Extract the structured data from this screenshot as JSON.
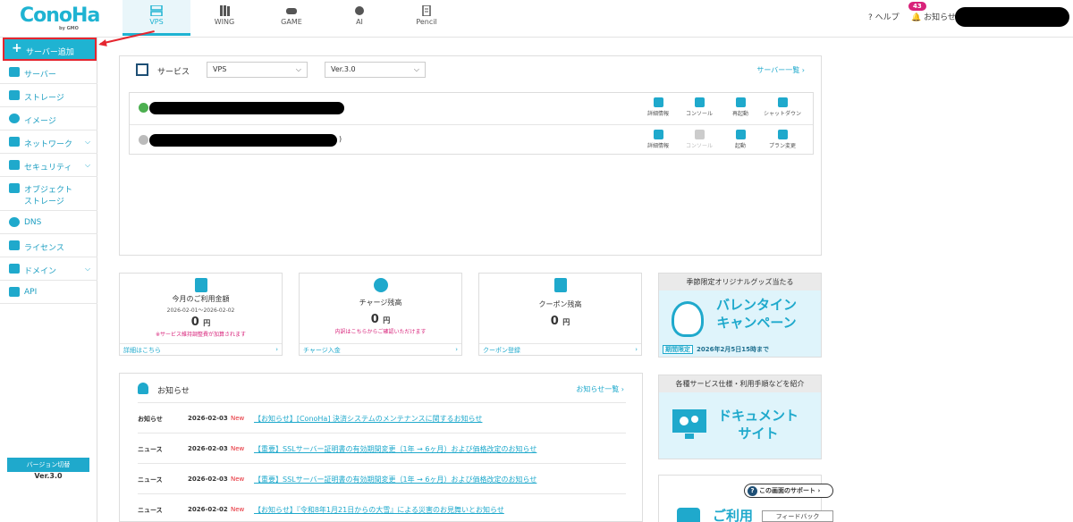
{
  "header": {
    "logo": "ConoHa",
    "logo_sub": "by GMO",
    "tabs": [
      {
        "label": "VPS",
        "icon": "server-icon",
        "active": true
      },
      {
        "label": "WING",
        "icon": "books-icon",
        "active": false
      },
      {
        "label": "GAME",
        "icon": "gamepad-icon",
        "active": false
      },
      {
        "label": "AI",
        "icon": "ai-chip-icon",
        "active": false
      },
      {
        "label": "Pencil",
        "icon": "pencil-icon",
        "active": false
      }
    ],
    "help_label": "ヘルプ",
    "notification_label": "お知らせ",
    "notification_count": "43"
  },
  "sidebar": {
    "add_server_label": "サーバー追加",
    "items": [
      {
        "label": "サーバー",
        "icon": "server-icon"
      },
      {
        "label": "ストレージ",
        "icon": "storage-icon"
      },
      {
        "label": "イメージ",
        "icon": "globe-icon"
      },
      {
        "label": "ネットワーク",
        "icon": "network-icon"
      },
      {
        "label": "セキュリティ",
        "icon": "key-icon"
      },
      {
        "label": "オブジェクト",
        "label2": "ストレージ",
        "icon": "folder-icon"
      },
      {
        "label": "DNS",
        "icon": "globe-icon"
      },
      {
        "label": "ライセンス",
        "icon": "license-icon"
      },
      {
        "label": "ドメイン",
        "icon": "domain-icon"
      },
      {
        "label": "API",
        "icon": "api-icon"
      }
    ],
    "version_switch_label": "バージョン切替",
    "version_label": "Ver.3.0"
  },
  "services": {
    "title": "サービス",
    "type_select": "VPS",
    "version_select": "Ver.3.0",
    "list_link": "サーバー一覧",
    "row1_suffix": "",
    "row2_suffix": ")",
    "row1_actions": [
      "詳細情報",
      "コンソール",
      "再起動",
      "シャットダウン"
    ],
    "row2_actions": [
      "詳細情報",
      "コンソール",
      "起動",
      "プラン変更"
    ]
  },
  "cards": [
    {
      "title": "今月のご利用金額",
      "sub": "2026-02-01～2026-02-02",
      "value": "0",
      "unit": "円",
      "note": "※サービス維持調整費が加算されます",
      "footer": "詳細はこちら"
    },
    {
      "title": "チャージ残高",
      "sub": "",
      "value": "0",
      "unit": "円",
      "note": "内訳はこちらからご確認いただけます",
      "footer": "チャージ入金"
    },
    {
      "title": "クーポン残高",
      "sub": "",
      "value": "0",
      "unit": "円",
      "note": "",
      "footer": "クーポン登録"
    }
  ],
  "banners": {
    "valentine_head": "季節限定オリジナルグッズ当たる",
    "valentine_line1": "バレンタイン",
    "valentine_line2": "キャンペーン",
    "valentine_tag": "期間限定",
    "valentine_date": "2026年2月5日15時まで",
    "docs_head": "各種サービス仕様・利用手順などを紹介",
    "docs_line1": "ドキュメント",
    "docs_line2": "サイト",
    "guide_partial": "ご利用"
  },
  "news": {
    "title": "お知らせ",
    "list_link": "お知らせ一覧",
    "items": [
      {
        "category": "お知らせ",
        "date": "2026-02-03",
        "new": "New",
        "text": "【お知らせ】[ConoHa] 決済システムのメンテナンスに関するお知らせ"
      },
      {
        "category": "ニュース",
        "date": "2026-02-03",
        "new": "New",
        "text": "【重要】SSLサーバー証明書の有効期間変更（1年 → 6ヶ月）および価格改定のお知らせ"
      },
      {
        "category": "ニュース",
        "date": "2026-02-03",
        "new": "New",
        "text": "【重要】SSLサーバー証明書の有効期間変更（1年 → 6ヶ月）および価格改定のお知らせ"
      },
      {
        "category": "ニュース",
        "date": "2026-02-02",
        "new": "New",
        "text": "【お知らせ】『令和8年1月21日からの大雪』による災害のお見舞いとお知らせ"
      }
    ]
  },
  "support_label": "この画面のサポート",
  "feedback_label": "フィードバック",
  "colors": {
    "accent": "#1fb3d2",
    "highlight": "#e5262f",
    "badge": "#d8227a"
  }
}
